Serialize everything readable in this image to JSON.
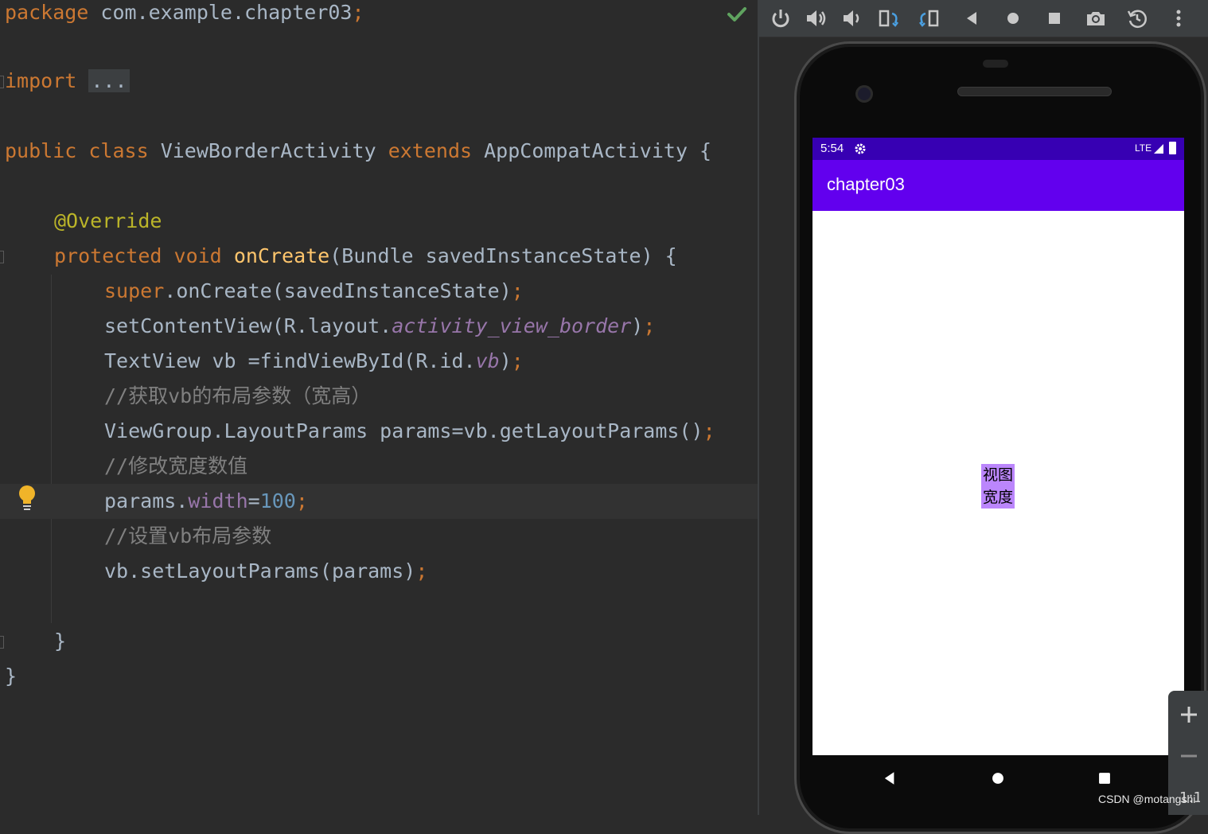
{
  "editor": {
    "line_package": {
      "kw": "package",
      "text": " com.example.chapter03",
      "semi": ";"
    },
    "line_import": {
      "kw": "import",
      "fold": "..."
    },
    "line_class": {
      "kw1": "public",
      "kw2": "class",
      "name": "ViewBorderActivity",
      "kw3": "extends",
      "parent": "AppCompatActivity",
      "brace": " {"
    },
    "line_override": "@Override",
    "line_oncreate": {
      "kw1": "protected",
      "kw2": "void",
      "fn": "onCreate",
      "rest": "(Bundle savedInstanceState) {"
    },
    "line_super": {
      "kw": "super",
      "rest": ".onCreate(savedInstanceState)",
      "semi": ";"
    },
    "line_setcontent": {
      "pre": "setContentView(R.layout.",
      "ital": "activity_view_border",
      "post": ")",
      "semi": ";"
    },
    "line_textview": {
      "pre": "TextView vb =findViewById(R.id.",
      "ital": "vb",
      "post": ")",
      "semi": ";"
    },
    "comment1": "//获取vb的布局参数（宽高）",
    "line_params": {
      "pre": "ViewGroup.LayoutParams params=vb.getLayoutParams()",
      "semi": ";"
    },
    "comment2": "//修改宽度数值",
    "line_width": {
      "pre": "params.",
      "field": "width",
      "eq": "=",
      "num": "100",
      "semi": ";"
    },
    "comment3": "//设置vb布局参数",
    "line_setlayout": {
      "pre": "vb.setLayoutParams(params)",
      "semi": ";"
    },
    "close_inner": "}",
    "close_outer": "}"
  },
  "emulator": {
    "toolbar_icons": [
      "power-icon",
      "volume-up-icon",
      "volume-down-icon",
      "rotate-left-icon",
      "rotate-right-icon",
      "back-icon",
      "home-icon",
      "overview-icon",
      "camera-icon",
      "snapshot-icon",
      "more-icon"
    ],
    "status": {
      "time": "5:54",
      "network": "LTE"
    },
    "app_title": "chapter03",
    "textview_text": "视图宽度",
    "colors": {
      "status_bar": "#3700b3",
      "app_bar": "#6200ee",
      "textview_bg": "#bb86fc"
    }
  },
  "zoom": {
    "icons": [
      "zoom-in-icon",
      "zoom-out-icon",
      "actual-size-icon"
    ]
  },
  "watermark": "CSDN @motangshi"
}
